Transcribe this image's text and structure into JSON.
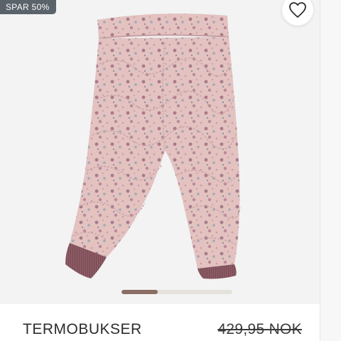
{
  "product": {
    "badge": "SPAR 50%",
    "name": "TERMOBUKSER",
    "original_price": "429,95 NOK",
    "image_alt": "TERMOBUKSER",
    "image_subject": "quilted floral pink baby thermo pants"
  },
  "wishlist": {
    "icon": "heart-icon"
  },
  "carousel": {
    "progress": 0.33
  },
  "colors": {
    "badge_bg": "#5a626a",
    "fabric": "#e2bfbd",
    "cuff": "#8b5a63",
    "indicator_active": "#8a6d63",
    "indicator_track": "#e5e1dd"
  }
}
